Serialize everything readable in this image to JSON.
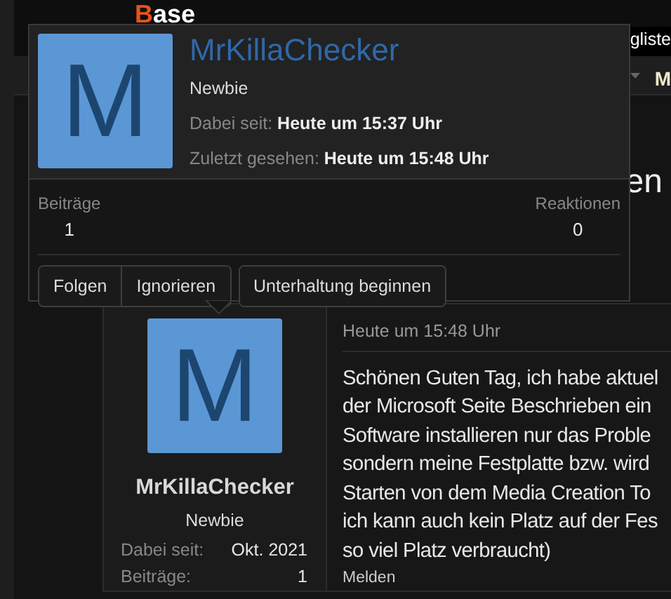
{
  "header": {
    "logo_initial": "B",
    "logo_rest": "ase",
    "nav_link": "gliste"
  },
  "nav": {
    "item": "M"
  },
  "heading": "en",
  "popup": {
    "name": "MrKillaChecker",
    "avatar_letter": "M",
    "role": "Newbie",
    "facts": [
      {
        "label": "Dabei seit:",
        "value": "Heute um 15:37 Uhr"
      },
      {
        "label": "Zuletzt gesehen:",
        "value": "Heute um 15:48 Uhr"
      }
    ],
    "stats": [
      {
        "label": "Beiträge",
        "value": "1"
      },
      {
        "label": "Reaktionen",
        "value": "0"
      }
    ],
    "button_groups": [
      {
        "buttons": [
          "Folgen",
          "Ignorieren"
        ]
      },
      {
        "buttons": [
          "Unterhaltung beginnen"
        ]
      }
    ]
  },
  "post": {
    "avatar_letter": "M",
    "name": "MrKillaChecker",
    "role": "Newbie",
    "facts": [
      {
        "label": "Dabei seit:",
        "value": "Okt. 2021"
      },
      {
        "label": "Beiträge:",
        "value": "1"
      }
    ],
    "date": "Heute um 15:48 Uhr",
    "lines": [
      "Schönen Guten Tag, ich habe aktuel",
      "der Microsoft Seite Beschrieben ein",
      "Software installieren nur das Proble",
      "sondern meine Festplatte bzw. wird",
      "Starten von dem Media Creation To",
      "ich kann auch kein Platz auf der Fes",
      "so viel Platz verbraucht)"
    ],
    "report": "Melden"
  }
}
